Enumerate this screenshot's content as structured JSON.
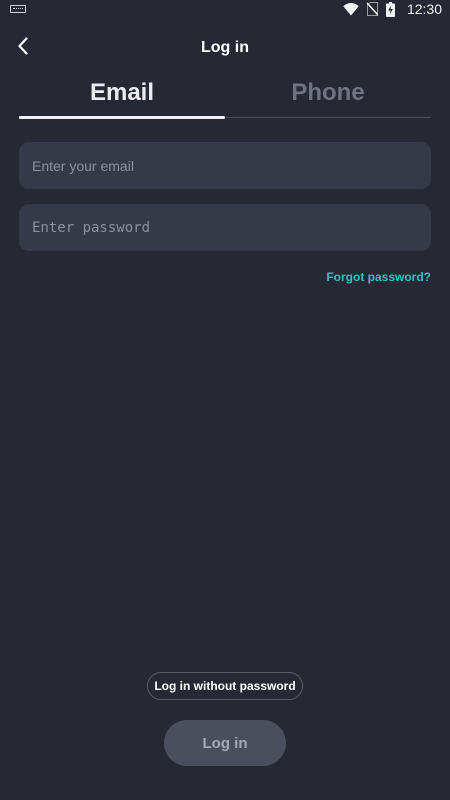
{
  "status_bar": {
    "time": "12:30",
    "icons": [
      "keyboard-icon",
      "wifi-icon",
      "no-sim-icon",
      "battery-charging-icon"
    ]
  },
  "header": {
    "back_icon": "chevron-left-icon",
    "title": "Log in"
  },
  "tabs": [
    {
      "label": "Email",
      "active": true
    },
    {
      "label": "Phone",
      "active": false
    }
  ],
  "form": {
    "email": {
      "value": "",
      "placeholder": "Enter your email"
    },
    "password": {
      "value": "",
      "placeholder": "Enter password"
    },
    "forgot_label": "Forgot password?"
  },
  "actions": {
    "passwordless_label": "Log in without password",
    "login_label": "Log in"
  },
  "colors": {
    "background": "#262834",
    "input_bg": "#363948",
    "accent_link": "#35c0c8",
    "button_disabled_bg": "#4b4e5c"
  }
}
